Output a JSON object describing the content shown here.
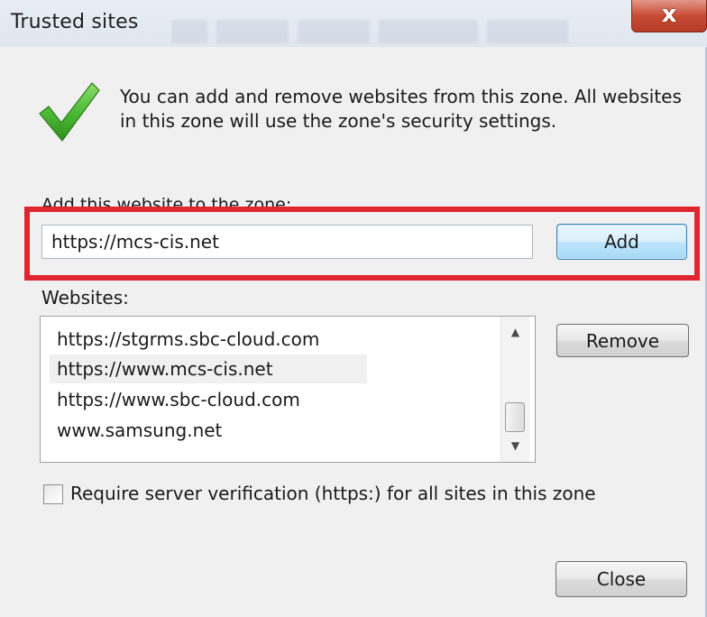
{
  "window": {
    "title": "Trusted sites",
    "close_glyph": "x"
  },
  "intro": {
    "icon": "checkmark-icon",
    "text": "You can add and remove websites from this zone. All websites in this zone will use the zone's security settings."
  },
  "add_site": {
    "label": "Add this website to the zone:",
    "input_value": "https://mcs-cis.net",
    "add_button_label": "Add"
  },
  "websites": {
    "label": "Websites:",
    "items": [
      "https://stgrms.sbc-cloud.com",
      "https://www.mcs-cis.net",
      "https://www.sbc-cloud.com",
      "www.samsung.net"
    ],
    "remove_button_label": "Remove"
  },
  "require_verification": {
    "label": "Require server verification (https:) for all sites in this zone",
    "checked": false
  },
  "close_button_label": "Close",
  "colors": {
    "highlight_border": "#e0252e",
    "check_green": "#3fae2a",
    "close_red": "#c84a33"
  }
}
